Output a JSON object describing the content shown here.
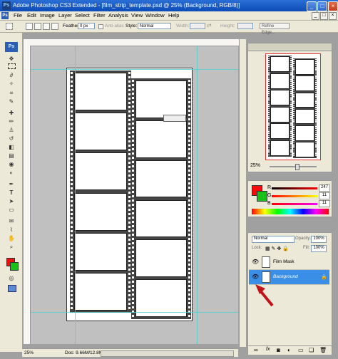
{
  "window": {
    "title": "Adobe Photoshop CS3 Extended - [film_strip_template.psd @ 25% (Background, RGB/8)]",
    "app_badge": "Ps",
    "buttons": [
      "_",
      "□",
      "×"
    ]
  },
  "menu": {
    "items": [
      "File",
      "Edit",
      "Image",
      "Layer",
      "Select",
      "Filter",
      "Analysis",
      "View",
      "Window",
      "Help"
    ],
    "mdi_buttons": [
      "_",
      "□",
      "×"
    ]
  },
  "options": {
    "feather_label": "Feather:",
    "feather_value": "0 px",
    "antialias_label": "Anti-alias",
    "style_label": "Style:",
    "style_value": "Normal",
    "width_label": "Width:",
    "height_label": "Height:",
    "refine_label": "Refine Edge..."
  },
  "toolbox": {
    "logo": "Ps",
    "foreground_color": "#e81010",
    "background_color": "#18c018"
  },
  "status": {
    "zoom": "25%",
    "doc": "Doc: 9.66M/12.8M"
  },
  "navigator": {
    "zoom": "25%"
  },
  "color": {
    "r_label": "R",
    "g_label": "G",
    "b_label": "B",
    "r": "247",
    "g": "11",
    "b": "11",
    "fg": "#f70b0b"
  },
  "layers": {
    "blend_mode": "Normal",
    "opacity_label": "Opacity:",
    "opacity": "100%",
    "lock_label": "Lock:",
    "fill_label": "Fill:",
    "fill": "100%",
    "items": [
      {
        "name": "Film Mask",
        "selected": false
      },
      {
        "name": "Background",
        "selected": true
      }
    ],
    "footer_icons": [
      "link-icon",
      "fx-icon",
      "mask-icon",
      "adjustment-icon",
      "folder-icon",
      "new-layer-icon",
      "trash-icon"
    ]
  },
  "accent": {
    "selection_blue": "#3b8ee6",
    "arrow_red": "#c0141a",
    "guide_cyan": "#4fd0d0"
  }
}
